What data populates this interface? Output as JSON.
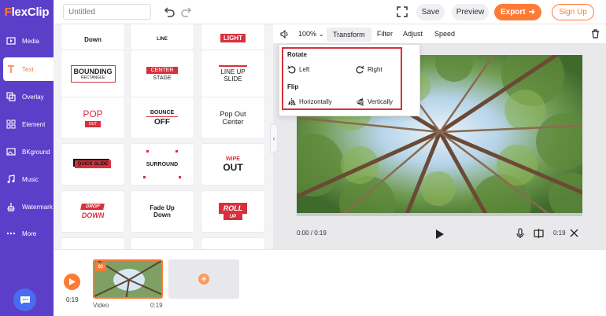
{
  "header": {
    "logo": "FlexClip",
    "title_placeholder": "Untitled",
    "save_label": "Save",
    "preview_label": "Preview",
    "export_label": "Export",
    "signup_label": "Sign Up"
  },
  "sidebar": {
    "items": [
      {
        "label": "Media",
        "icon": "media-icon"
      },
      {
        "label": "Text",
        "icon": "text-icon",
        "active": true
      },
      {
        "label": "Overlay",
        "icon": "overlay-icon"
      },
      {
        "label": "Element",
        "icon": "element-icon"
      },
      {
        "label": "BKground",
        "icon": "background-icon"
      },
      {
        "label": "Music",
        "icon": "music-icon"
      },
      {
        "label": "Watermark",
        "icon": "watermark-icon"
      },
      {
        "label": "More",
        "icon": "more-icon"
      }
    ]
  },
  "templates": [
    {
      "lines": [
        "Down"
      ]
    },
    {
      "lines": [
        "LINE"
      ]
    },
    {
      "lines": [
        "LIGHT"
      ]
    },
    {
      "lines": [
        "BOUNDING",
        "RECTANGLE"
      ]
    },
    {
      "lines": [
        "CENTER",
        "STAGE"
      ]
    },
    {
      "lines": [
        "LINE UP",
        "SLIDE"
      ]
    },
    {
      "lines": [
        "POP",
        "OUT"
      ]
    },
    {
      "lines": [
        "BOUNCE",
        "OFF"
      ]
    },
    {
      "lines": [
        "Pop Out",
        "Center"
      ]
    },
    {
      "lines": [
        "QUICK SLIDE"
      ]
    },
    {
      "lines": [
        "SURROUND"
      ]
    },
    {
      "lines": [
        "WIPE",
        "OUT"
      ]
    },
    {
      "lines": [
        "DROP",
        "DOWN"
      ]
    },
    {
      "lines": [
        "Fade Up",
        "Down"
      ]
    },
    {
      "lines": [
        "ROLL",
        "UP"
      ]
    }
  ],
  "toolbar": {
    "zoom": "100%",
    "transform": "Transform",
    "filter": "Filter",
    "adjust": "Adjust",
    "speed": "Speed"
  },
  "transform_menu": {
    "rotate_label": "Rotate",
    "rotate_left": "Left",
    "rotate_right": "Right",
    "flip_label": "Flip",
    "flip_h": "Horizontally",
    "flip_v": "Vertically"
  },
  "player": {
    "current_time": "0:00 / 0:19",
    "duration": "0:19"
  },
  "timeline": {
    "total_time": "0:19",
    "clip_index": "01",
    "clip_label": "Video",
    "clip_duration": "0:19"
  },
  "colors": {
    "brand_purple": "#5b3fc9",
    "accent_orange": "#ff7a35",
    "highlight_red": "#d9303c"
  }
}
